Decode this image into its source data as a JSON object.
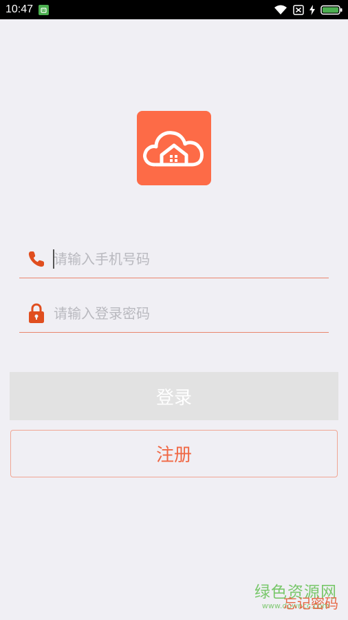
{
  "status_bar": {
    "time": "10:47",
    "icons": [
      "android-icon",
      "wifi-icon",
      "no-sim-icon",
      "charging-icon",
      "battery-icon"
    ]
  },
  "logo": {
    "icon": "cloud-house-icon",
    "color": "#fd6b47"
  },
  "form": {
    "phone": {
      "icon": "phone-icon",
      "placeholder": "请输入手机号码",
      "value": ""
    },
    "password": {
      "icon": "lock-icon",
      "placeholder": "请输入登录密码",
      "value": ""
    }
  },
  "buttons": {
    "login_label": "登录",
    "register_label": "注册"
  },
  "forgot_password_label": "忘记密码",
  "watermark": {
    "title": "绿色资源网",
    "url": "www.downcc.com"
  },
  "colors": {
    "accent": "#f06845",
    "background": "#f0eff4",
    "login_disabled": "#e2e2e2"
  }
}
